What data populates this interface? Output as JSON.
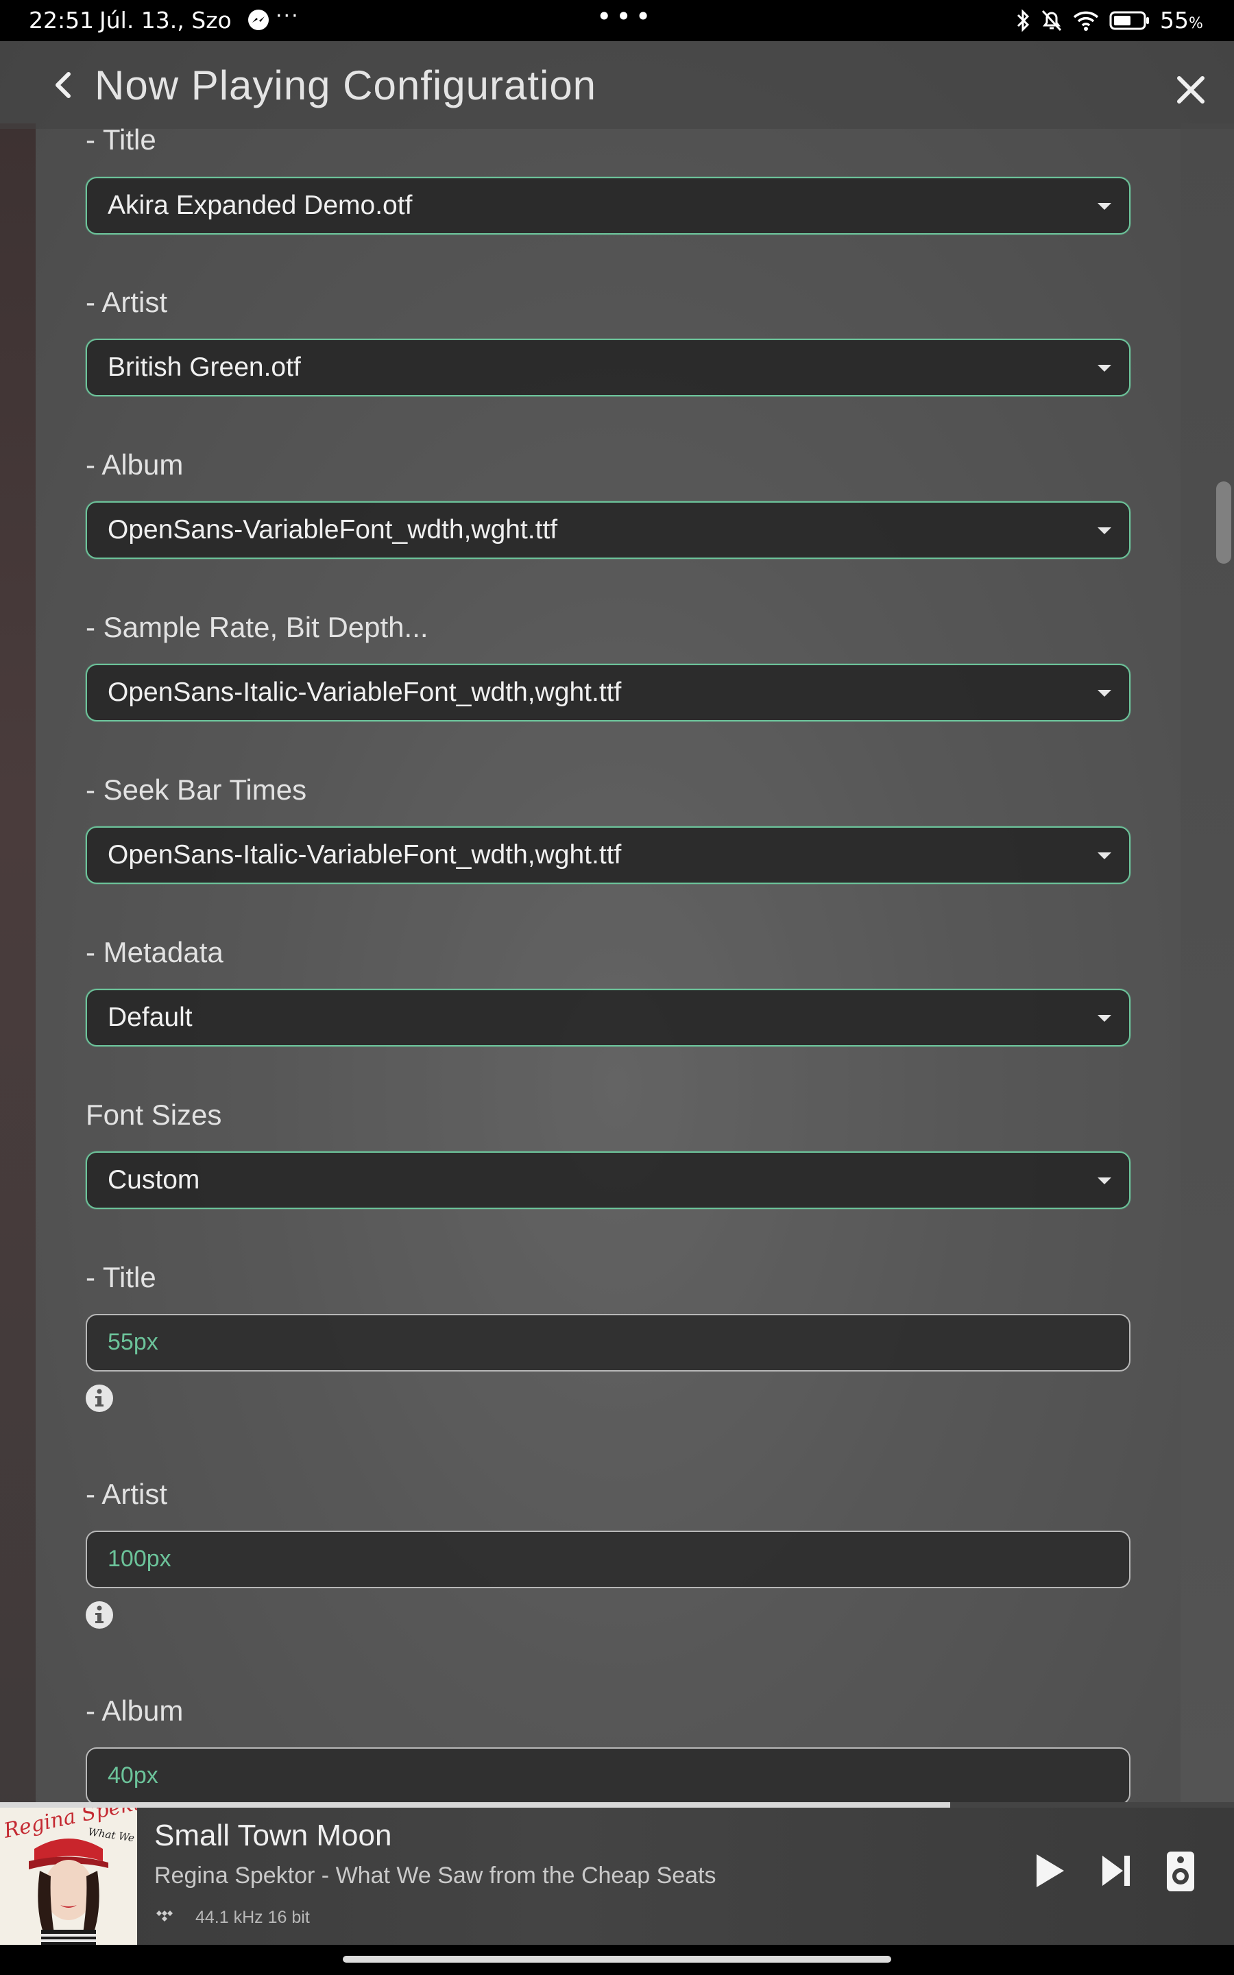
{
  "status_bar": {
    "time": "22:51",
    "date": "Júl. 13., Szo",
    "left_more": "···",
    "center_more": "•••",
    "battery_percent": "55",
    "battery_unit": "%"
  },
  "header": {
    "title": "Now Playing Configuration"
  },
  "font_selects": [
    {
      "label": "- Title",
      "value": "Akira Expanded Demo.otf"
    },
    {
      "label": "- Artist",
      "value": "British Green.otf"
    },
    {
      "label": "- Album",
      "value": "OpenSans-VariableFont_wdth,wght.ttf"
    },
    {
      "label": "- Sample Rate, Bit Depth...",
      "value": "OpenSans-Italic-VariableFont_wdth,wght.ttf"
    },
    {
      "label": "- Seek Bar Times",
      "value": "OpenSans-Italic-VariableFont_wdth,wght.ttf"
    },
    {
      "label": "- Metadata",
      "value": "Default"
    }
  ],
  "font_sizes": {
    "label": "Font Sizes",
    "value": "Custom",
    "fields": [
      {
        "label": "- Title",
        "value": "55px"
      },
      {
        "label": "- Artist",
        "value": "100px"
      },
      {
        "label": "- Album",
        "value": "40px"
      }
    ]
  },
  "now_playing": {
    "song": "Small Town Moon",
    "artist_album": "Regina Spektor - What We Saw from the Cheap Seats",
    "quality": "44.1 kHz 16 bit",
    "progress": 0.77,
    "art_text": {
      "artist_name": "Regina Spektor",
      "album_name": "What We Saw from the Cheap Seats"
    }
  },
  "colors": {
    "accent_green": "#6cc39a"
  },
  "icons": {
    "back": "chevron-left-icon",
    "close": "close-icon",
    "info": "info-icon",
    "play": "play-icon",
    "next": "skip-next-icon",
    "speaker": "speaker-icon"
  }
}
